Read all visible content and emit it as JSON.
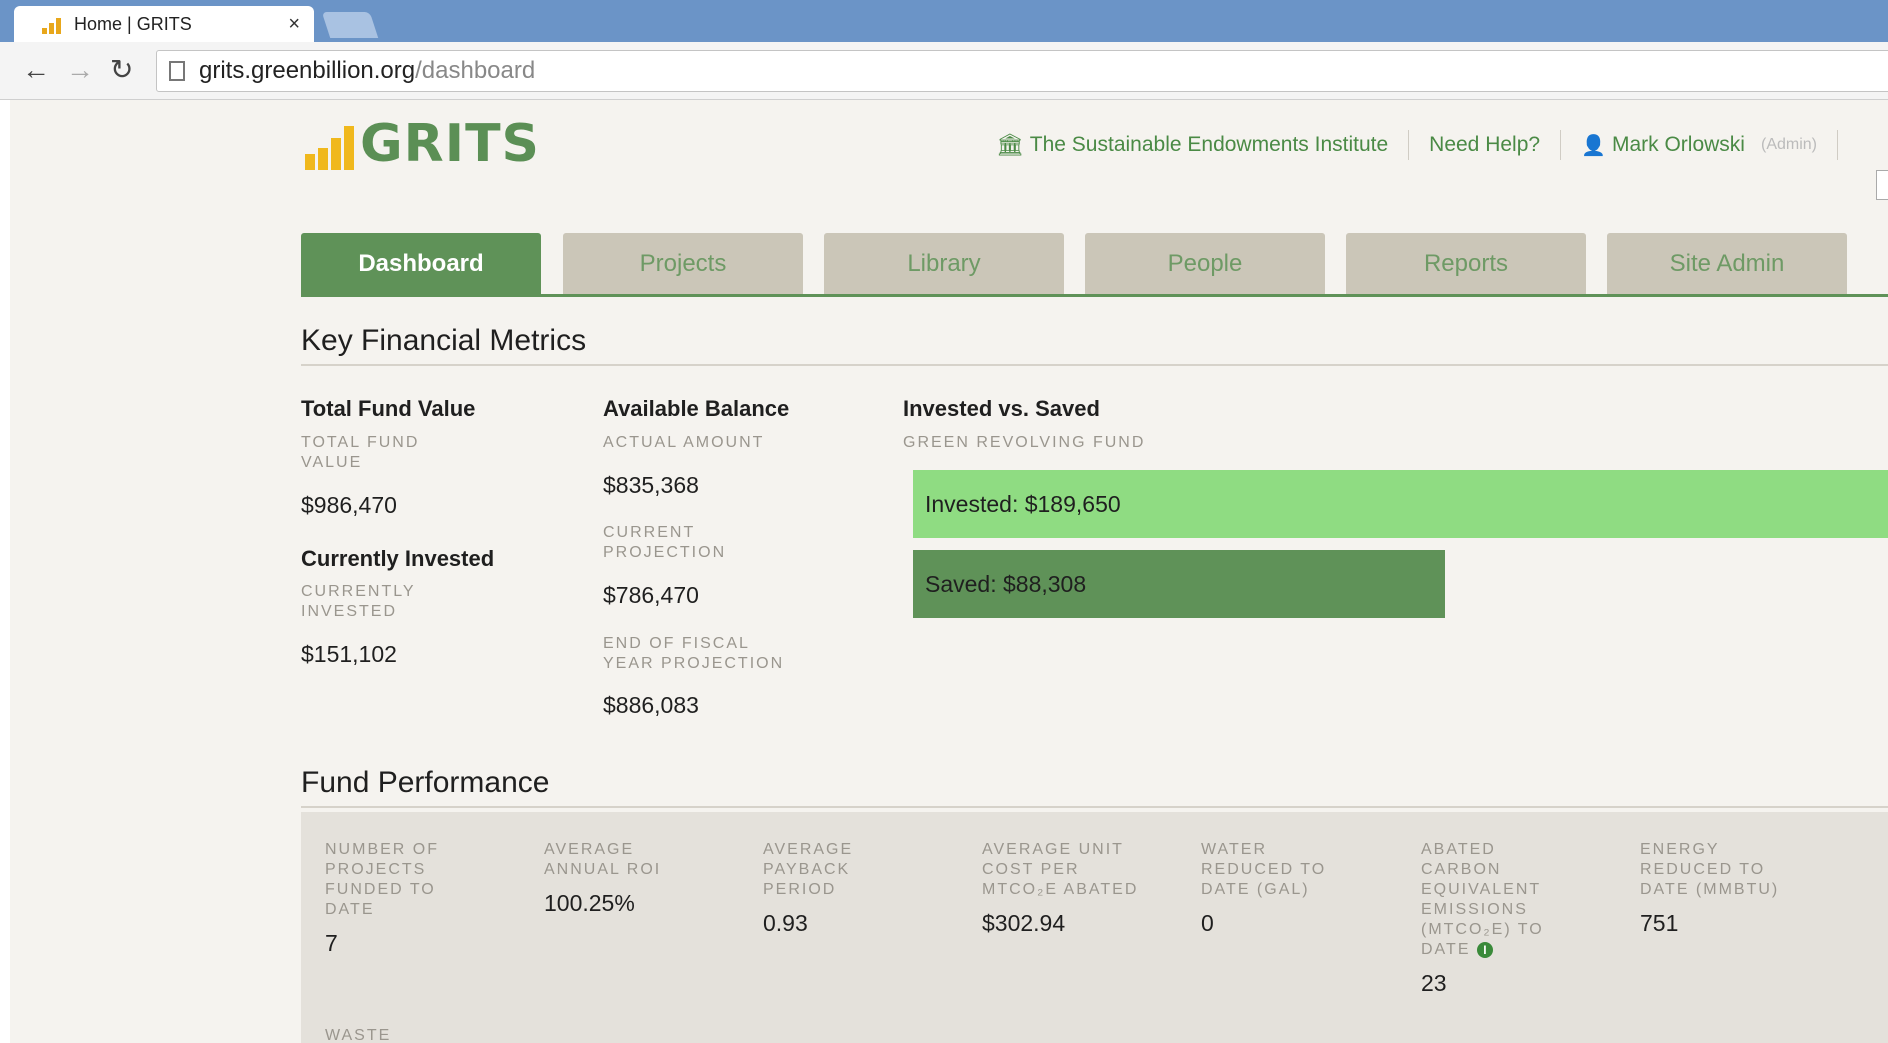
{
  "browser": {
    "tab_title": "Home | GRITS",
    "tab_close": "×",
    "url_host": "grits.greenbillion.org",
    "url_path": "/dashboard"
  },
  "header": {
    "logo_text": "GRITS",
    "institution": "The Sustainable Endowments Institute",
    "help": "Need Help?",
    "user": "Mark Orlowski",
    "role": "(Admin)"
  },
  "tabs": [
    {
      "label": "Dashboard",
      "active": true
    },
    {
      "label": "Projects",
      "active": false
    },
    {
      "label": "Library",
      "active": false
    },
    {
      "label": "People",
      "active": false
    },
    {
      "label": "Reports",
      "active": false
    },
    {
      "label": "Site Admin",
      "active": false
    }
  ],
  "key_metrics": {
    "title": "Key Financial Metrics",
    "total_fund": {
      "heading": "Total Fund Value",
      "sub": "TOTAL FUND VALUE",
      "value": "$986,470"
    },
    "currently_invested": {
      "heading": "Currently Invested",
      "sub": "CURRENTLY INVESTED",
      "value": "$151,102"
    },
    "available_balance": {
      "heading": "Available Balance",
      "actual_sub": "ACTUAL AMOUNT",
      "actual_value": "$835,368",
      "current_sub": "CURRENT PROJECTION",
      "current_value": "$786,470",
      "eofy_sub": "END OF FISCAL YEAR PROJECTION",
      "eofy_value": "$886,083"
    },
    "invested_vs_saved": {
      "heading": "Invested vs. Saved",
      "sub": "GREEN REVOLVING FUND",
      "invested_label": "Invested: $189,650",
      "saved_label": "Saved: $88,308",
      "invested_amount": 189650,
      "saved_amount": 88308,
      "invested_color": "#8fdc82",
      "saved_color": "#5f9258"
    }
  },
  "fund_performance": {
    "title": "Fund Performance",
    "metrics": [
      {
        "label": "NUMBER OF PROJECTS FUNDED TO DATE",
        "value": "7"
      },
      {
        "label": "AVERAGE ANNUAL ROI",
        "value": "100.25%"
      },
      {
        "label": "AVERAGE PAYBACK PERIOD",
        "value": "0.93"
      },
      {
        "label": "AVERAGE UNIT COST PER MTCO₂E ABATED",
        "value": "$302.94"
      },
      {
        "label": "WATER REDUCED TO DATE (GAL)",
        "value": "0"
      },
      {
        "label": "ABATED CARBON EQUIVALENT EMISSIONS (MTCO₂E) TO DATE",
        "value": "23",
        "info_icon": "info-icon"
      },
      {
        "label": "ENERGY REDUCED TO DATE (MMBTU)",
        "value": "751"
      }
    ],
    "next_label": "WASTE"
  },
  "colors": {
    "brand_green": "#5f9258",
    "logo_yellow": "#f0b81c",
    "page_bg": "#f5f3ef"
  }
}
